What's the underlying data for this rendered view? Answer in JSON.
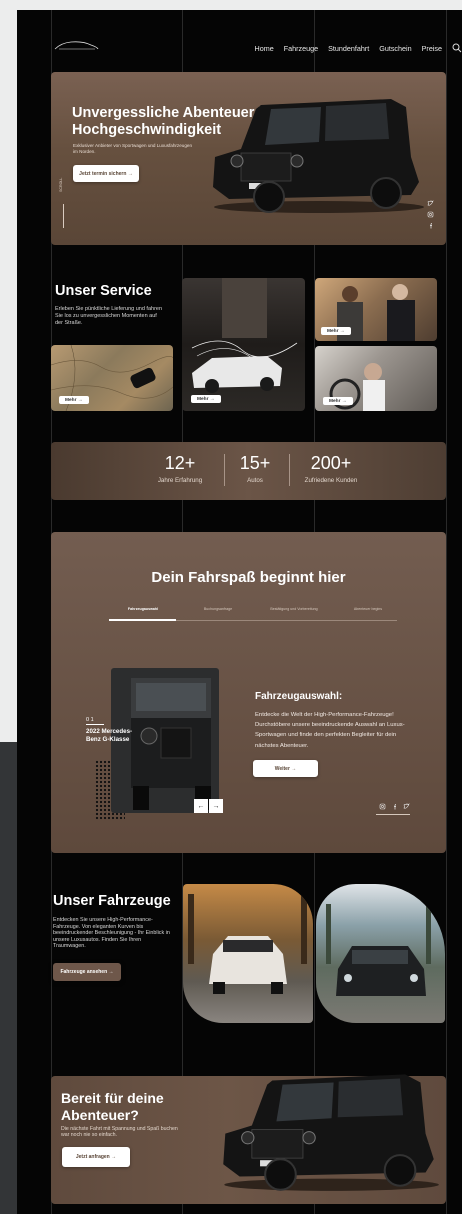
{
  "nav": {
    "items": [
      "Home",
      "Fahrzeuge",
      "Stundenfahrt",
      "Gutschein",
      "Preise"
    ],
    "search_icon": "search-icon"
  },
  "hero": {
    "title": "Unvergessliche Abenteuer in Hochgeschwindigkeit",
    "subtitle": "Exklusiver Anbieter von Sportwagen und Luxusfahrzeugen im Norden.",
    "cta": "Jetzt termin sichern →",
    "scroll": "SCROLL",
    "social": [
      "twitter-icon",
      "instagram-icon",
      "facebook-icon"
    ]
  },
  "service": {
    "title": "Unser Service",
    "text": "Erleben Sie pünktliche Lieferung und fahren Sie los zu unvergesslichen Momenten auf der Straße.",
    "more": "Mehr →"
  },
  "stats": [
    {
      "value": "12+",
      "label": "Jahre Erfahrung"
    },
    {
      "value": "15+",
      "label": "Autos"
    },
    {
      "value": "200+",
      "label": "Zufriedene Kunden"
    }
  ],
  "fahrspass": {
    "title": "Dein Fahrspaß beginnt hier",
    "steps": [
      "Fahrzeugauswahl",
      "Buchungsanfrage",
      "Bestätigung und Vorbereitung",
      "Abenteuer begins"
    ],
    "car_index": "0 1",
    "car_name": "2022 Mercedes-Benz G-Klasse",
    "section_title": "Fahrzeugauswahl:",
    "section_text": "Entdecke die Welt der High-Performance-Fahrzeuge! Durchstöbere unsere beeindruckende Auswahl an Luxus-Sportwagen und finde den perfekten Begleiter für dein nächstes Abenteuer.",
    "next": "Weiter →",
    "prev_arrow": "←",
    "next_arrow": "→"
  },
  "fahrzeuge": {
    "title": "Unser Fahrzeuge",
    "text": "Entdecken Sie unsere High-Performance-Fahrzeuge. Von eleganten Kurven bis beeindruckender Beschleunigung - Ihr Einblick in unsere Luxusautos. Finden Sie Ihren Traumwagen.",
    "cta": "Fahrzeuge ansehen →"
  },
  "bereit": {
    "title": "Bereit für deine Abenteuer?",
    "text": "Die nächste Fahrt mit Spannung und Spaß buchen war noch nie so einfach.",
    "cta": "Jetzt anfragen →"
  },
  "colors": {
    "accent_brown": "#6e574a",
    "page_bg": "#050505"
  }
}
